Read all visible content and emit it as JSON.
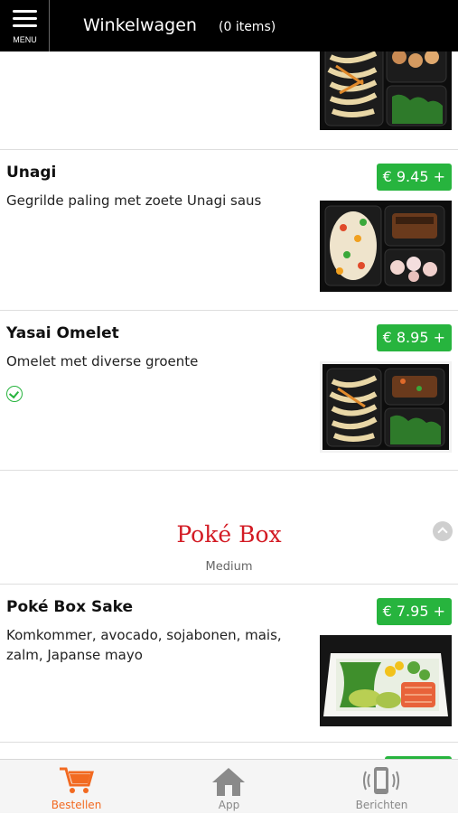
{
  "header": {
    "menu_label": "MENU",
    "title": "Winkelwagen",
    "cart_count": "(0 items)"
  },
  "items": [
    {
      "name": "Unagi",
      "description": "Gegrilde paling met zoete Unagi saus",
      "price": "€ 9.45 +"
    },
    {
      "name": "Yasai Omelet",
      "description": "Omelet met diverse groente",
      "price": "€ 8.95 +",
      "vegetarian": true
    },
    {
      "name": "Poké Box Sake",
      "description": "Komkommer, avocado, sojabonen, mais, zalm, Japanse mayo",
      "price": "€ 7.95 +"
    }
  ],
  "section": {
    "title": "Poké Box",
    "subtitle": "Medium"
  },
  "tabbar": {
    "tabs": [
      {
        "label": "Bestellen",
        "icon": "cart-icon",
        "active": true
      },
      {
        "label": "App",
        "icon": "home-icon",
        "active": false
      },
      {
        "label": "Berichten",
        "icon": "phone-vibrate-icon",
        "active": false
      }
    ]
  },
  "colors": {
    "price_badge": "#27b43e",
    "section_title": "#d31b24",
    "active_tab": "#f26a21",
    "inactive_tab": "#888888"
  }
}
